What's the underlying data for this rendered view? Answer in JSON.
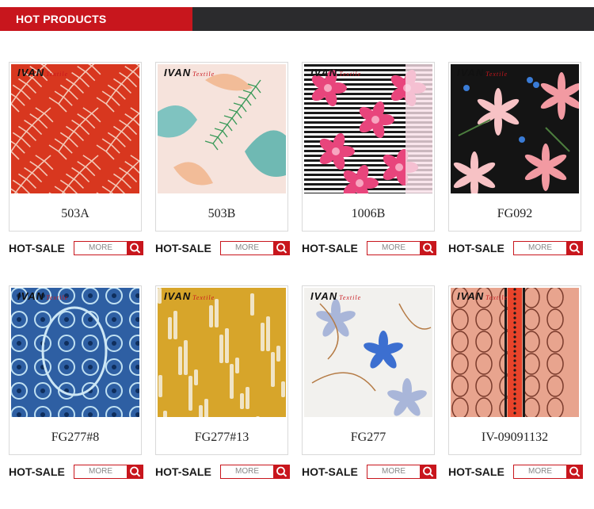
{
  "header": {
    "title": "HOT PRODUCTS"
  },
  "brand": {
    "name": "IVAN",
    "sub": "Textile"
  },
  "more_label": "MORE",
  "hot_label": "HOT-SALE",
  "products": [
    {
      "code": "503A",
      "pattern": "red-palm-leaves"
    },
    {
      "code": "503B",
      "pattern": "peach-tropical-leaves"
    },
    {
      "code": "1006B",
      "pattern": "pink-floral-stripes"
    },
    {
      "code": "FG092",
      "pattern": "black-lily-floral"
    },
    {
      "code": "FG277#8",
      "pattern": "blue-paisley"
    },
    {
      "code": "FG277#13",
      "pattern": "mustard-brushstroke"
    },
    {
      "code": "FG277",
      "pattern": "white-blue-floral"
    },
    {
      "code": "IV-09091132",
      "pattern": "coral-paisley-band"
    }
  ],
  "colors": {
    "accent": "#c8161d",
    "header_dark": "#2b2b2d"
  }
}
